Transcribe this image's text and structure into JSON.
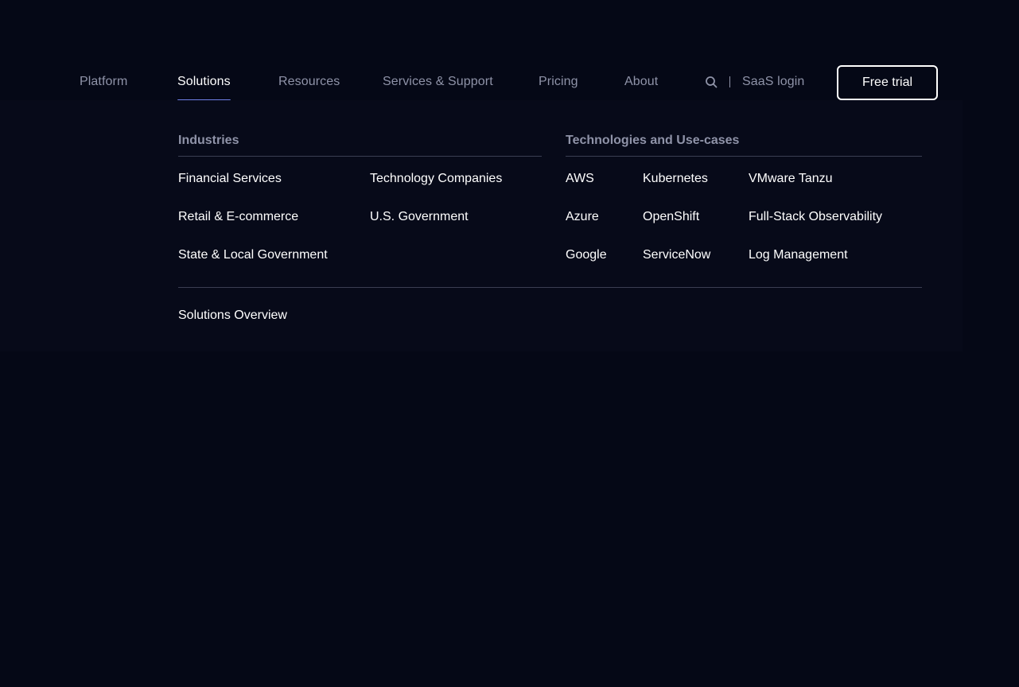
{
  "nav": {
    "items": [
      {
        "label": "Platform"
      },
      {
        "label": "Solutions"
      },
      {
        "label": "Resources"
      },
      {
        "label": "Services & Support"
      },
      {
        "label": "Pricing"
      },
      {
        "label": "About"
      }
    ],
    "active": "Solutions",
    "saas_login": "SaaS login",
    "free_trial": "Free trial",
    "search_icon": "search-icon"
  },
  "menu": {
    "industries": {
      "heading": "Industries",
      "links": [
        "Financial Services",
        "Technology Companies",
        "Retail & E-commerce",
        "U.S. Government",
        "State & Local Government"
      ]
    },
    "technologies": {
      "heading": "Technologies and Use-cases",
      "links": [
        "AWS",
        "Kubernetes",
        "VMware Tanzu",
        "Azure",
        "OpenShift",
        "Full-Stack Observability",
        "Google",
        "ServiceNow",
        "Log Management"
      ]
    },
    "overview": "Solutions Overview"
  },
  "colors": {
    "background": "#050816",
    "muted_text": "#8f93a8",
    "accent_underline": "#6f7fe6",
    "divider": "#3a3e52"
  }
}
